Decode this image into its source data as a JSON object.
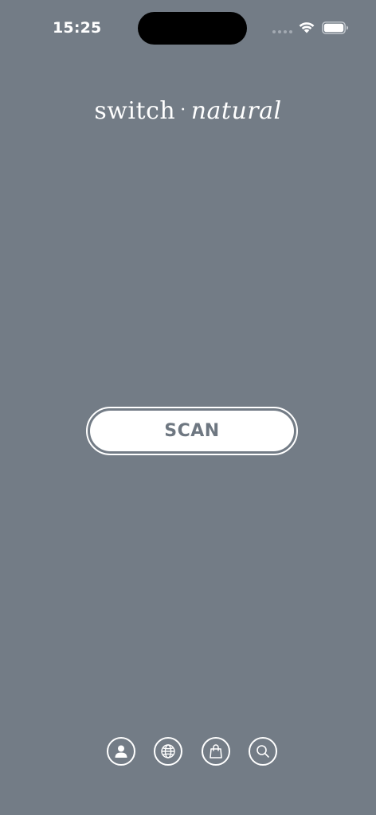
{
  "status_bar": {
    "time": "15:25"
  },
  "logo": {
    "word1": "switch",
    "separator": "·",
    "word2": "natural"
  },
  "main": {
    "scan_label": "SCAN"
  },
  "bottom_nav": {
    "items": [
      {
        "icon": "person-icon"
      },
      {
        "icon": "globe-icon"
      },
      {
        "icon": "shopping-bag-icon"
      },
      {
        "icon": "search-icon"
      }
    ]
  },
  "colors": {
    "background": "#737c86",
    "button_text": "#6e7781",
    "foreground": "#ffffff"
  }
}
